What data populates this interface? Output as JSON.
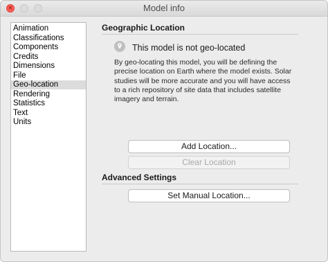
{
  "window": {
    "title": "Model info",
    "close_glyph": "×"
  },
  "sidebar": {
    "items": [
      {
        "label": "Animation"
      },
      {
        "label": "Classifications"
      },
      {
        "label": "Components"
      },
      {
        "label": "Credits"
      },
      {
        "label": "Dimensions"
      },
      {
        "label": "File"
      },
      {
        "label": "Geo-location"
      },
      {
        "label": "Rendering"
      },
      {
        "label": "Statistics"
      },
      {
        "label": "Text"
      },
      {
        "label": "Units"
      }
    ],
    "selected": "Geo-location"
  },
  "geo": {
    "section_title": "Geographic Location",
    "status_icon": "location-pin-icon",
    "status": "This model is not geo-located",
    "description": "By geo-locating this model, you will be defining the precise location on Earth where the model exists. Solar studies will be more accurate and you will have access to a rich repository of site data that includes satellite imagery and terrain.",
    "add_button": "Add Location...",
    "clear_button": "Clear Location"
  },
  "advanced": {
    "section_title": "Advanced Settings",
    "manual_button": "Set Manual Location..."
  },
  "colors": {
    "close_button": "#ff5f57",
    "window_bg": "#ececec",
    "selection_bg": "#dcdcdc"
  }
}
